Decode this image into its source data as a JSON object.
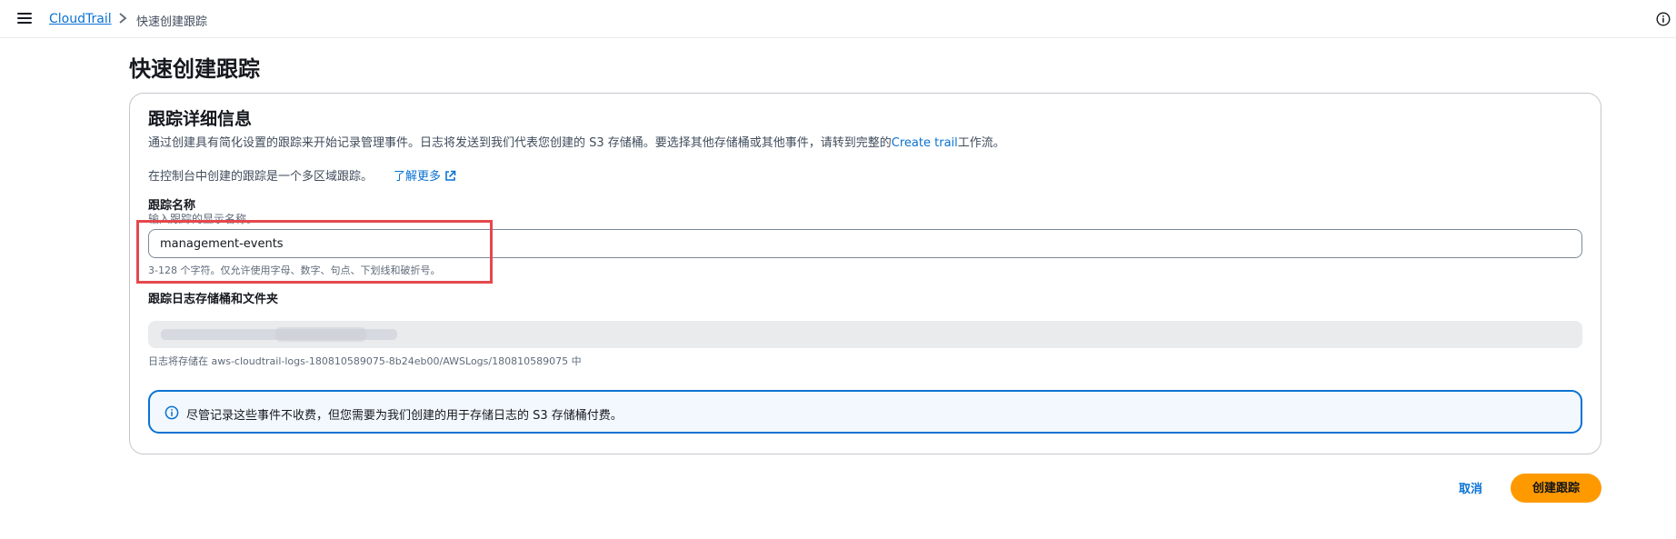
{
  "topbar": {
    "menu_icon": "hamburger-menu-icon",
    "breadcrumb": {
      "service": "CloudTrail",
      "separator_icon": "chevron-right-icon",
      "current": "快速创建跟踪"
    },
    "info_icon": "info-icon"
  },
  "page": {
    "title": "快速创建跟踪"
  },
  "details": {
    "title": "跟踪详细信息",
    "description_prefix": "通过创建具有简化设置的跟踪来开始记录管理事件。日志将发送到我们代表您创建的 S3 存储桶。要选择其他存储桶或其他事件，请转到完整的",
    "description_link": "Create trail",
    "description_suffix": "工作流。",
    "region_note": "在控制台中创建的跟踪是一个多区域跟踪。",
    "learn_more": "了解更多",
    "learn_more_icon": "external-link-icon"
  },
  "trail_name": {
    "label": "跟踪名称",
    "description": "输入跟踪的显示名称。",
    "value": "management-events",
    "constraint": "3-128 个字符。仅允许使用字母、数字、句点、下划线和破折号。"
  },
  "bucket": {
    "label": "跟踪日志存储桶和文件夹",
    "storage_note": "日志将存储在 aws-cloudtrail-logs-180810589075-8b24eb00/AWSLogs/180810589075 中"
  },
  "alert": {
    "icon": "info-circle-icon",
    "text": "尽管记录这些事件不收费，但您需要为我们创建的用于存储日志的 S3 存储桶付费。"
  },
  "actions": {
    "cancel": "取消",
    "create": "创建跟踪"
  },
  "colors": {
    "link": "#0972d3",
    "primary_button": "#ff9900",
    "highlight_box": "#e5484d",
    "alert_border": "#0972d3",
    "alert_bg": "#f2f8fd"
  }
}
